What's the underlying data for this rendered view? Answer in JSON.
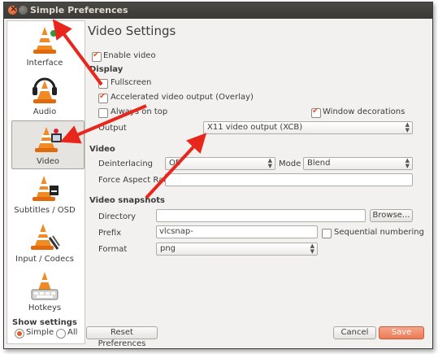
{
  "window": {
    "title": "Simple Preferences"
  },
  "sidebar": {
    "items": [
      {
        "label": "Interface",
        "icon": "vlc-cone-icon"
      },
      {
        "label": "Audio",
        "icon": "vlc-headphones-icon"
      },
      {
        "label": "Video",
        "icon": "vlc-video-icon",
        "selected": true
      },
      {
        "label": "Subtitles / OSD",
        "icon": "vlc-subtitles-icon"
      },
      {
        "label": "Input / Codecs",
        "icon": "vlc-codecs-icon"
      },
      {
        "label": "Hotkeys",
        "icon": "vlc-hotkeys-icon"
      }
    ]
  },
  "show_settings": {
    "label": "Show settings",
    "simple_label": "Simple",
    "all_label": "All",
    "selected": "Simple"
  },
  "main": {
    "title": "Video Settings",
    "enable_video": {
      "label": "Enable video",
      "checked": true
    },
    "display": {
      "label": "Display",
      "fullscreen": {
        "label": "Fullscreen",
        "checked": false
      },
      "overlay": {
        "label": "Accelerated video output (Overlay)",
        "checked": true
      },
      "always_on_top": {
        "label": "Always on top",
        "checked": false
      },
      "window_decorations": {
        "label": "Window decorations",
        "checked": true
      },
      "output_label": "Output",
      "output_value": "X11 video output (XCB)"
    },
    "video": {
      "label": "Video",
      "deinterlacing_label": "Deinterlacing",
      "deinterlacing_value": "Off",
      "mode_label": "Mode",
      "mode_value": "Blend",
      "aspect_label": "Force Aspect Ratio",
      "aspect_value": ""
    },
    "snapshots": {
      "label": "Video snapshots",
      "directory_label": "Directory",
      "directory_value": "",
      "browse_label": "Browse...",
      "prefix_label": "Prefix",
      "prefix_value": "vlcsnap-",
      "sequential_label": "Sequential numbering",
      "sequential_checked": false,
      "format_label": "Format",
      "format_value": "png"
    }
  },
  "footer": {
    "reset_label": "Reset Preferences",
    "cancel_label": "Cancel",
    "save_label": "Save"
  },
  "colors": {
    "accent": "#e45c2c",
    "annotation_arrow": "#e8261c",
    "titlebar": "#3c3b37"
  }
}
